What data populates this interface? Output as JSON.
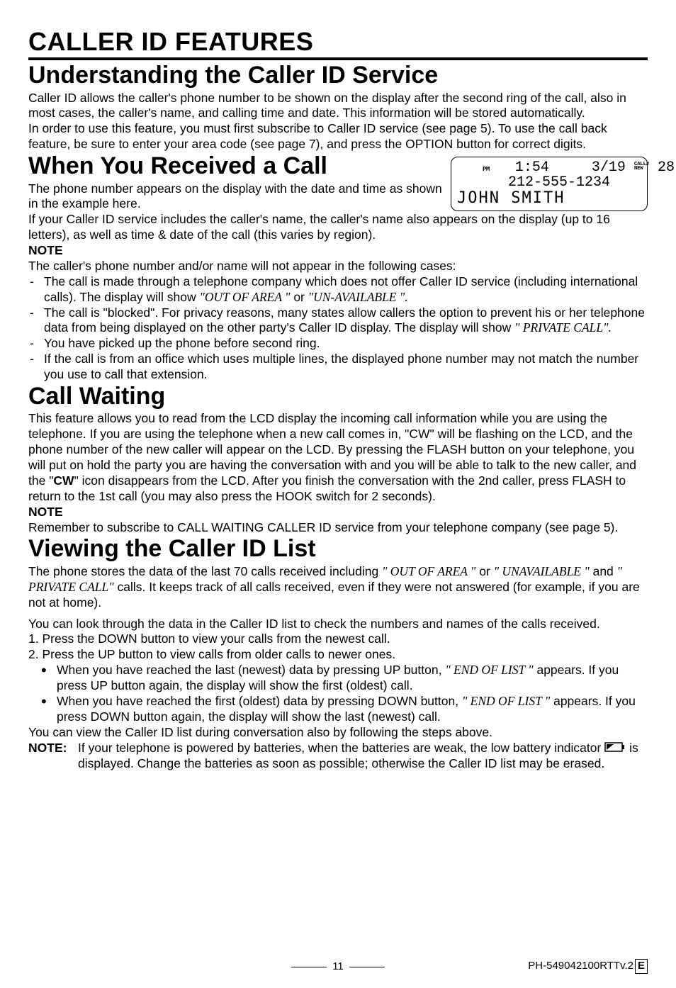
{
  "top_title": "CALLER ID FEATURES",
  "h_understand": "Understanding the Caller ID Service",
  "p_understand_1": "Caller ID allows the caller's phone number to be shown on the display after the second ring of the call, also in most cases, the caller's name, and calling time and date.  This information will be stored automatically.",
  "p_understand_2": "In order to use this feature, you must first subscribe to Caller ID service (see page 5). To use the call back feature, be sure to enter your area code (see page 7), and press the OPTION button for correct digits.",
  "h_received": "When You Received a Call",
  "p_received_1": "The phone number appears on the display with the date and time as shown in the example here.",
  "p_received_2": "If your Caller ID service includes the caller's name, the caller's name also appears on the display (up to 16 letters), as well as time & date of the call (this varies by region).",
  "note_label": "NOTE",
  "p_note1_intro": "The caller's phone number and/or name will not appear in the following cases:",
  "note1_b1_a": "The call is made through a telephone company which does not offer Caller ID service (including international calls).  The display will show ",
  "note1_b1_i1": "\"OUT OF AREA \"",
  "note1_b1_b": " or ",
  "note1_b1_i2": "\"UN-AVAILABLE \".",
  "note1_b2_a": "The call is \"blocked\".  For privacy reasons, many states allow callers the option to prevent his or her telephone data from being displayed on the other party's Caller ID display. The display will show ",
  "note1_b2_i": "\" PRIVATE CALL\".",
  "note1_b3": "You have picked up the phone before second ring.",
  "note1_b4": "If the call is from an office which uses multiple lines, the displayed phone number may not match the number you use to call that extension.",
  "h_callwait": "Call Waiting",
  "p_callwait_a": "This feature allows you to read from the LCD display the incoming call information while you are using the telephone.  If you are using the telephone when a new call comes in, \"CW\" will be flashing on the LCD, and the phone number of the new caller will appear on the LCD.  By pressing the FLASH button on your telephone, you will put on hold the party you are having the conversation with and you will be able to talk to the new caller, and the \"",
  "p_callwait_cw": "CW",
  "p_callwait_b": "\" icon disappears from the LCD.  After you finish the conversation with the 2nd caller, press FLASH to return to the 1st call (you may also press the HOOK switch for 2 seconds).",
  "p_callwait_note": "Remember to subscribe to CALL WAITING CALLER ID service from your telephone company (see page 5).",
  "h_viewing": "Viewing the Caller ID List",
  "p_view_1a": "The phone stores the data of the last 70 calls received including ",
  "p_view_1i1": "\" OUT OF AREA \"",
  "p_view_1b": " or ",
  "p_view_1i2": "\" UNAVAILABLE \"",
  "p_view_1c": " and ",
  "p_view_1i3": "\" PRIVATE CALL\"",
  "p_view_1d": " calls. It keeps track of all calls received, even if they were not answered (for example, if you are not at home).",
  "p_view_2": "You can look through the data in the Caller ID list to check the numbers and names of the calls received.",
  "p_view_step1": "1. Press the DOWN button to view your calls from the newest call.",
  "p_view_step2": "2. Press the UP button to view calls from older calls to newer ones.",
  "p_view_b1a": "When you have reached the last (newest) data by pressing UP button, ",
  "p_view_b1i": "\" END OF LIST \"",
  "p_view_b1b": " appears. If you press UP button again, the display will show the first (oldest) call.",
  "p_view_b2a": "When you have reached the first (oldest) data by pressing DOWN button, ",
  "p_view_b2i": "\" END OF LIST \"",
  "p_view_b2b": " appears. If you press DOWN button again, the display will show the last (newest) call.",
  "p_view_3": "You can view the Caller ID list during conversation also by following the steps above.",
  "note2_label": "NOTE:",
  "p_note2_a": "If your telephone is powered by batteries, when the batteries are weak, the low battery indicator ",
  "p_note2_b": " is displayed. Change the batteries as soon as possible; otherwise the Caller ID list may be erased.",
  "lcd": {
    "pm": "PM",
    "time": "1:54",
    "date": "3/19",
    "call_lbl": "CALL#",
    "new_lbl": "NEW",
    "count": "28",
    "phone": "212-555-1234",
    "name": "JOHN  SMITH"
  },
  "footer": {
    "page": "11",
    "docid": "PH-549042100RTTv.2",
    "rev": "E"
  }
}
